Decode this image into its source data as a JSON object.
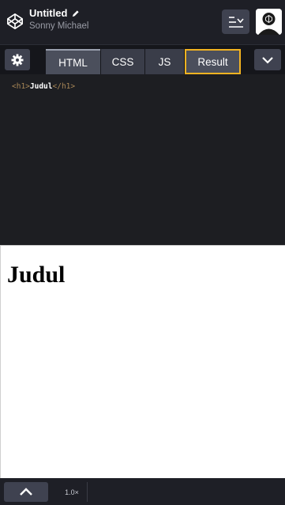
{
  "header": {
    "title": "Untitled",
    "author": "Sonny Michael",
    "logo_icon": "codepen-logo-icon",
    "edit_icon": "pencil-icon",
    "layout_icon": "layout-toggle-icon",
    "avatar_icon": "user-avatar-icon"
  },
  "tabs": {
    "settings_icon": "gear-icon",
    "items": [
      {
        "label": "HTML"
      },
      {
        "label": "CSS"
      },
      {
        "label": "JS"
      },
      {
        "label": "Result"
      }
    ],
    "collapse_icon": "chevron-down-icon"
  },
  "editor": {
    "open_tag": "<h1>",
    "content": "Judul",
    "close_tag": "</h1>"
  },
  "preview": {
    "heading": "Judul"
  },
  "footer": {
    "expand_icon": "chevron-up-icon",
    "zoom": "1.0×"
  },
  "colors": {
    "header_bg": "#1e1f26",
    "editor_bg": "#1d1e22",
    "result_tab_border": "#f2b321",
    "tag_color": "#a88757"
  }
}
